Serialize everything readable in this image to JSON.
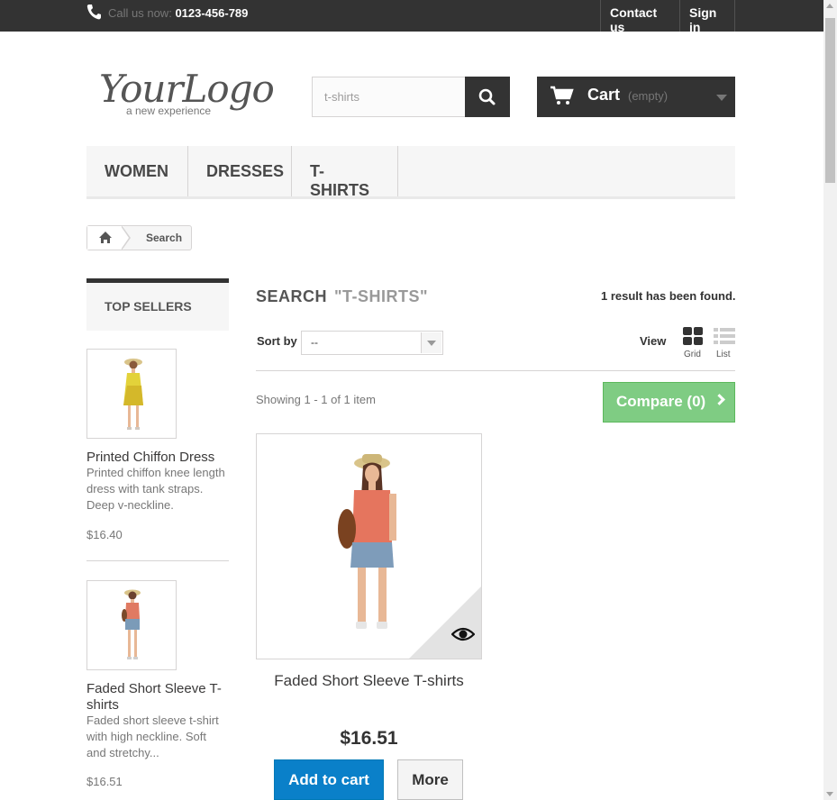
{
  "topbar": {
    "call_label": "Call us now:",
    "phone": "0123-456-789",
    "contact": "Contact us",
    "signin": "Sign in"
  },
  "logo": {
    "brand": "YourLogo",
    "tagline": "a new experience"
  },
  "search": {
    "value": "t-shirts"
  },
  "cart": {
    "label": "Cart",
    "status": "(empty)"
  },
  "menu": {
    "items": [
      "WOMEN",
      "DRESSES",
      "T-SHIRTS"
    ]
  },
  "breadcrumb": {
    "current": "Search"
  },
  "top_sellers": {
    "heading": "TOP SELLERS",
    "items": [
      {
        "name": "Printed Chiffon Dress",
        "description": "Printed chiffon knee length dress with tank straps. Deep v-neckline.",
        "price": "$16.40"
      },
      {
        "name": "Faded Short Sleeve T-shirts",
        "description": "Faded short sleeve t-shirt with high neckline. Soft and stretchy...",
        "price": "$16.51"
      }
    ]
  },
  "main": {
    "heading": "SEARCH",
    "query": "\"T-SHIRTS\"",
    "result_count": "1 result has been found.",
    "sort_label": "Sort by",
    "sort_value": "--",
    "view_label": "View",
    "grid_label": "Grid",
    "list_label": "List",
    "showing": "Showing 1 - 1 of 1 item",
    "compare": "Compare (0)"
  },
  "product": {
    "name": "Faded Short Sleeve T-shirts",
    "price": "$16.51",
    "add_to_cart": "Add to cart",
    "more": "More"
  },
  "colors": {
    "dark": "#333333",
    "compare_green": "#7fcc83",
    "cart_blue": "#0a80c9"
  }
}
